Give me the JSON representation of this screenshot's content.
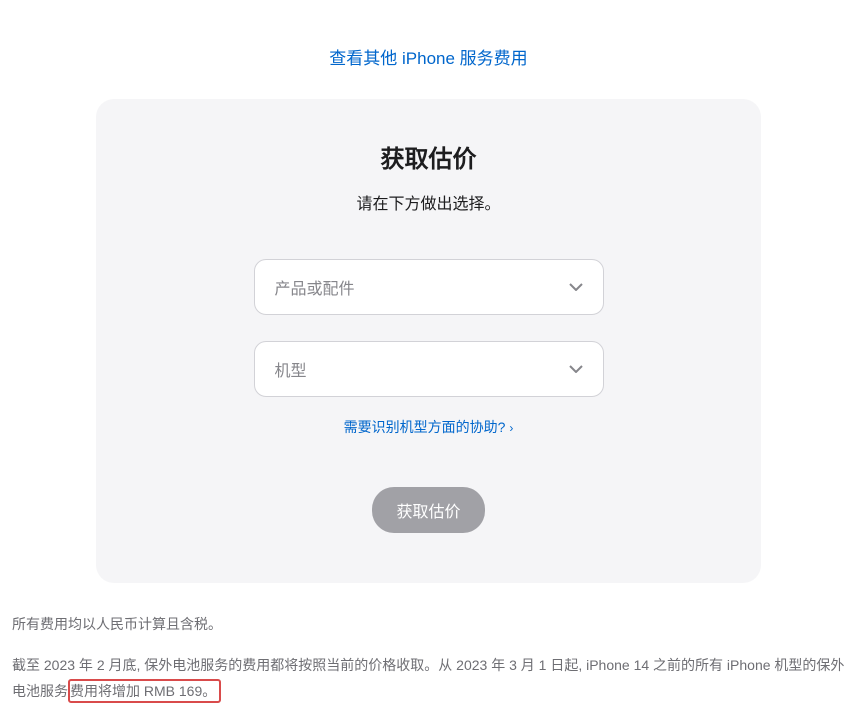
{
  "topLink": {
    "label": "查看其他 iPhone 服务费用"
  },
  "card": {
    "title": "获取估价",
    "subtitle": "请在下方做出选择。",
    "select1": {
      "placeholder": "产品或配件"
    },
    "select2": {
      "placeholder": "机型"
    },
    "helpLink": {
      "label": "需要识别机型方面的协助?"
    },
    "submitButton": {
      "label": "获取估价"
    }
  },
  "footer": {
    "line1": "所有费用均以人民币计算且含税。",
    "line2Start": "截至 2023 年 2 月底, 保外电池服务的费用都将按照当前的价格收取。从 2023 年 3 月 1 日起, iPhone 14 之前的所有 iPhone 机型的保外电池服务",
    "line2Highlight": "费用将增加 RMB 169。"
  }
}
